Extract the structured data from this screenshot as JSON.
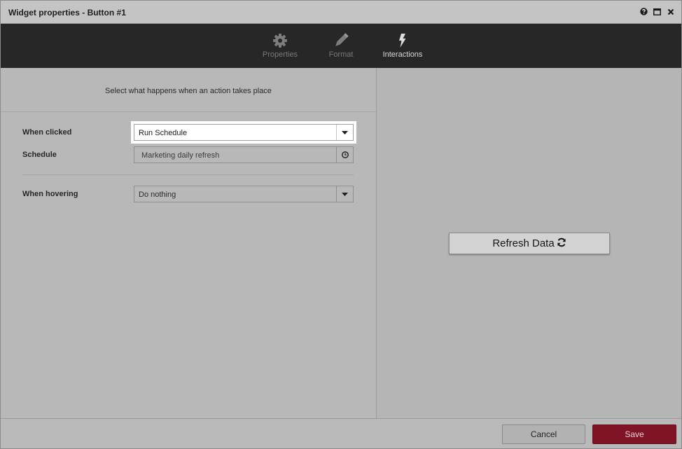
{
  "window": {
    "title": "Widget properties - Button #1",
    "controls": [
      "help-icon",
      "maximize-icon",
      "close-icon"
    ]
  },
  "tabs": [
    {
      "label": "Properties",
      "icon": "gear-icon",
      "active": false
    },
    {
      "label": "Format",
      "icon": "pencil-icon",
      "active": false
    },
    {
      "label": "Interactions",
      "icon": "lightning-icon",
      "active": true
    }
  ],
  "panel": {
    "instructions": "Select what happens when an action takes place",
    "when_clicked": {
      "label": "When clicked",
      "value": "Run Schedule"
    },
    "schedule": {
      "label": "Schedule",
      "value": "Marketing daily refresh"
    },
    "when_hovering": {
      "label": "When hovering",
      "value": "Do nothing"
    }
  },
  "preview": {
    "button_label": "Refresh Data",
    "button_icon": "refresh-icon"
  },
  "footer": {
    "cancel_label": "Cancel",
    "save_label": "Save"
  },
  "colors": {
    "tabbar": "#272727",
    "save": "#7f1426",
    "highlight": "#ffffff"
  }
}
